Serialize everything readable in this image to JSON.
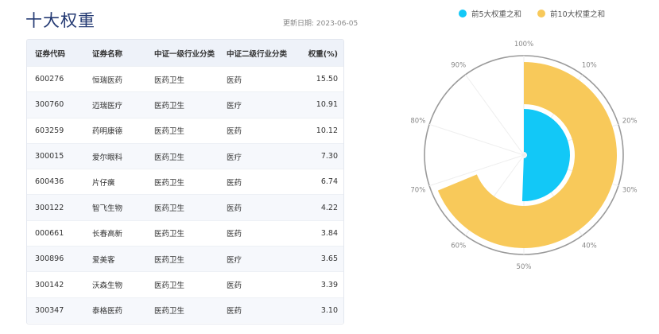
{
  "header": {
    "title": "十大权重",
    "update_date": "更新日期: 2023-06-05"
  },
  "table": {
    "columns": [
      "证券代码",
      "证券名称",
      "中证一级行业分类",
      "中证二级行业分类",
      "权重(%)"
    ],
    "rows": [
      [
        "600276",
        "恒瑞医药",
        "医药卫生",
        "医药",
        "15.50"
      ],
      [
        "300760",
        "迈瑞医疗",
        "医药卫生",
        "医疗",
        "10.91"
      ],
      [
        "603259",
        "药明康德",
        "医药卫生",
        "医药",
        "10.12"
      ],
      [
        "300015",
        "爱尔眼科",
        "医药卫生",
        "医疗",
        "7.30"
      ],
      [
        "600436",
        "片仔癀",
        "医药卫生",
        "医药",
        "6.74"
      ],
      [
        "300122",
        "智飞生物",
        "医药卫生",
        "医药",
        "4.22"
      ],
      [
        "000661",
        "长春高新",
        "医药卫生",
        "医药",
        "3.84"
      ],
      [
        "300896",
        "爱美客",
        "医药卫生",
        "医疗",
        "3.65"
      ],
      [
        "300142",
        "沃森生物",
        "医药卫生",
        "医药",
        "3.39"
      ],
      [
        "300347",
        "泰格医药",
        "医药卫生",
        "医药",
        "3.10"
      ]
    ]
  },
  "chart_data": {
    "type": "polar-bar",
    "angle_ticks": [
      "100%",
      "10%",
      "20%",
      "30%",
      "40%",
      "50%",
      "60%",
      "70%",
      "80%",
      "90%"
    ],
    "angle_range": [
      0,
      100
    ],
    "series": [
      {
        "name": "前5大权重之和",
        "value": 50.57,
        "color": "#12c8f7"
      },
      {
        "name": "前10大权重之和",
        "value": 68.77,
        "color": "#f8c95a"
      }
    ],
    "legend_position": "top-right"
  }
}
